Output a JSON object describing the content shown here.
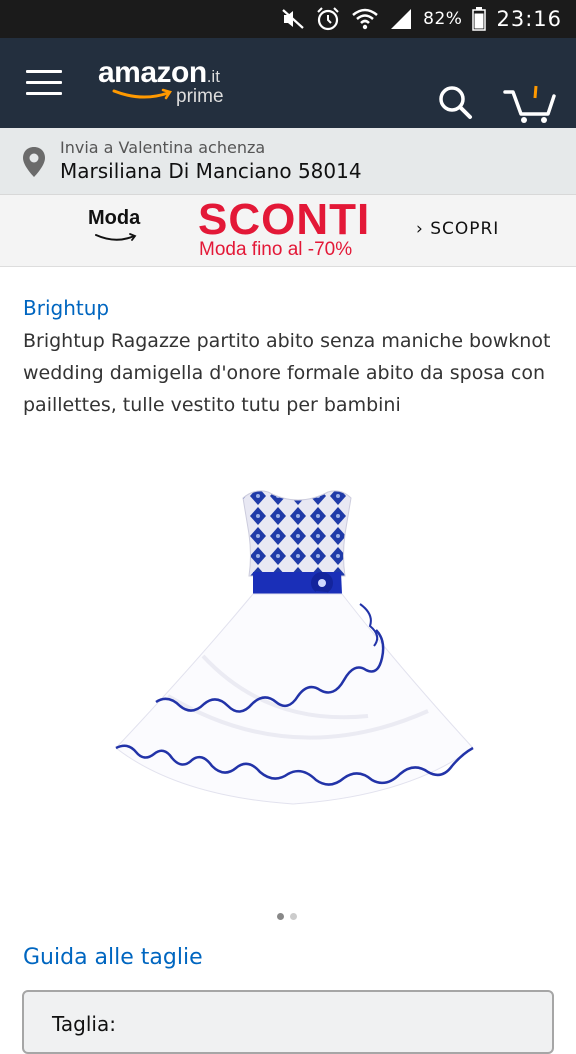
{
  "status_bar": {
    "battery": "82%",
    "time": "23:16",
    "icons": [
      "mute-icon",
      "alarm-icon",
      "wifi-icon",
      "signal-icon",
      "battery-icon"
    ]
  },
  "header": {
    "logo_text": "amazon",
    "logo_tld": ".it",
    "logo_sub": "prime",
    "icons": [
      "menu-icon",
      "search-icon",
      "cart-icon"
    ]
  },
  "location": {
    "line1": "Invia a Valentina achenza",
    "line2": "Marsiliana Di Manciano 58014"
  },
  "banner": {
    "moda": "Moda",
    "headline": "SCONTI",
    "sub": "Moda fino al -70%",
    "cta": "› SCOPRI"
  },
  "product": {
    "brand": "Brightup",
    "title": "Brightup Ragazze partito abito senza maniche bowknot wedding damigella d'onore formale abito da sposa con paillettes, tulle vestito tutu per bambini",
    "image_count": 2,
    "image_index": 1
  },
  "size": {
    "guide_link": "Guida alle taglie",
    "label": "Taglia:"
  },
  "colors": {
    "header_bg": "#232f3e",
    "accent_orange": "#ff9900",
    "link_blue": "#0066c0",
    "sale_red": "#e31837"
  }
}
